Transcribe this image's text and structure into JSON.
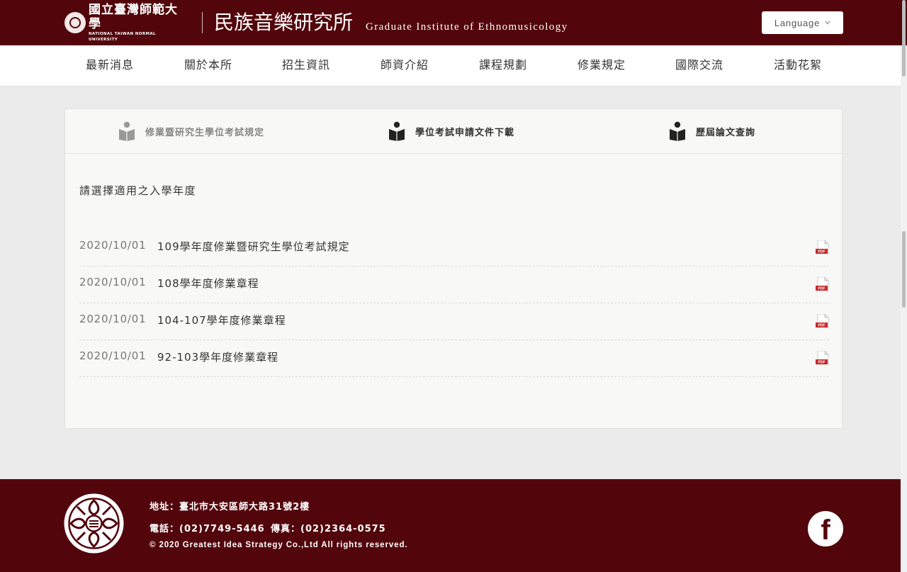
{
  "header": {
    "ntnu_cn": "國立臺灣師範大學",
    "ntnu_en": "NATIONAL TAIWAN NORMAL UNIVERSITY",
    "title_cn": "民族音樂研究所",
    "title_en": "Graduate Institute of Ethnomusicology",
    "language_label": "Language",
    "language_chevron": "chevron-down-icon",
    "brand_color": "#52060c"
  },
  "nav": {
    "items": [
      {
        "label": "最新消息"
      },
      {
        "label": "關於本所"
      },
      {
        "label": "招生資訊"
      },
      {
        "label": "師資介紹"
      },
      {
        "label": "課程規劃"
      },
      {
        "label": "修業規定"
      },
      {
        "label": "國際交流"
      },
      {
        "label": "活動花絮"
      }
    ]
  },
  "subtabs": [
    {
      "label": "修業暨研究生學位考試規定",
      "icon": "book-reader-icon",
      "active": true
    },
    {
      "label": "學位考試申請文件下載",
      "icon": "book-reader-icon",
      "active": false
    },
    {
      "label": "歷屆論文查詢",
      "icon": "book-reader-icon",
      "active": false
    }
  ],
  "main": {
    "hint": "請選擇適用之入學年度",
    "documents": [
      {
        "date": "2020/10/01",
        "title": "109學年度修業暨研究生學位考試規定",
        "icon": "pdf-icon"
      },
      {
        "date": "2020/10/01",
        "title": "108學年度修業章程",
        "icon": "pdf-icon"
      },
      {
        "date": "2020/10/01",
        "title": "104-107學年度修業章程",
        "icon": "pdf-icon"
      },
      {
        "date": "2020/10/01",
        "title": "92-103學年度修業章程",
        "icon": "pdf-icon"
      }
    ]
  },
  "footer": {
    "address": "地址：臺北市大安區師大路31號2樓",
    "phone": "電話：(02)7749-5446",
    "fax": "傳真：(02)2364-0575",
    "copyright": "© 2020 Greatest Idea Strategy Co.,Ltd All rights reserved.",
    "social_icon": "facebook-icon"
  }
}
